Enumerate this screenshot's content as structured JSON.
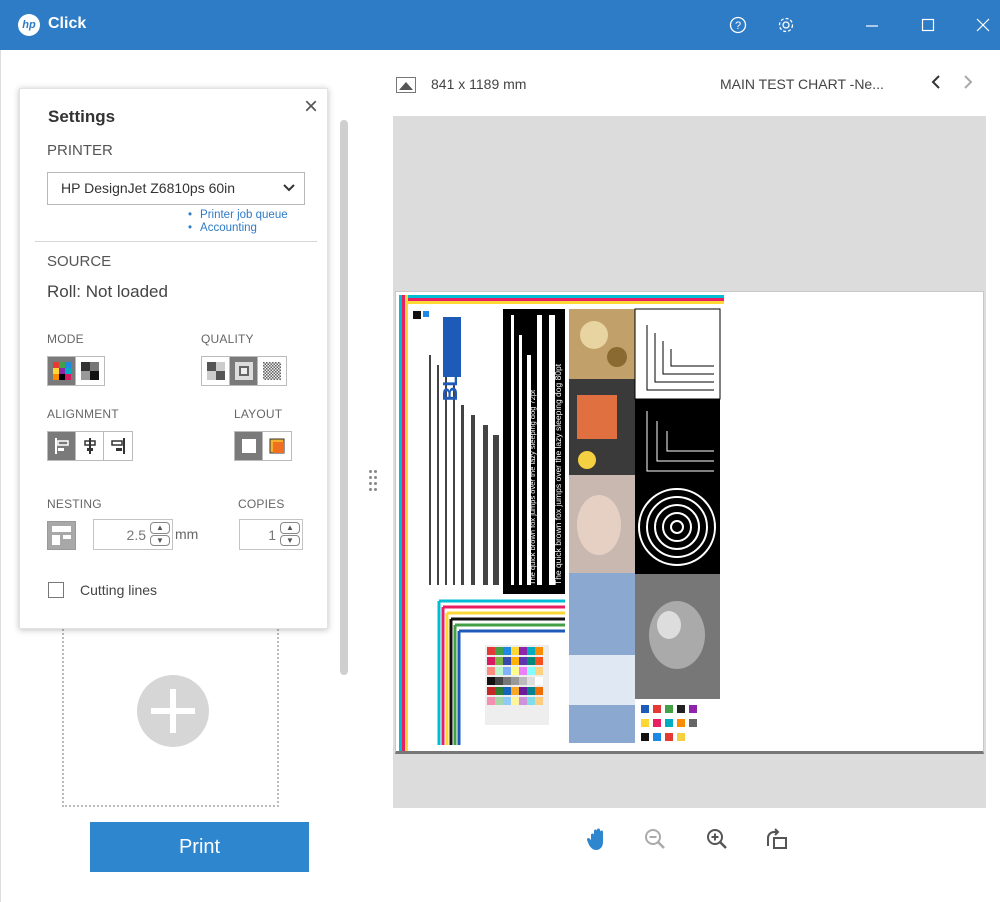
{
  "titlebar": {
    "app_logo": "hp",
    "app_title": "Click",
    "help_icon": "help-icon",
    "settings_icon": "gear-icon",
    "minimize_icon": "minimize-icon",
    "maximize_icon": "maximize-icon",
    "close_icon": "close-icon",
    "color": "#2e7bc6"
  },
  "settings": {
    "title": "Settings",
    "printer_label": "PRINTER",
    "printer_value": "HP DesignJet Z6810ps 60in",
    "links": [
      "Printer job queue",
      "Accounting"
    ],
    "source_label": "SOURCE",
    "source_value": "Roll: Not loaded",
    "mode_label": "MODE",
    "quality_label": "QUALITY",
    "alignment_label": "ALIGNMENT",
    "layout_label": "LAYOUT",
    "nesting_label": "NESTING",
    "nesting_value": "2.5",
    "nesting_unit": "mm",
    "copies_label": "COPIES",
    "copies_value": "1",
    "cutting_lines_label": "Cutting lines"
  },
  "print_button": "Print",
  "preview": {
    "size": "841 x 1189 mm",
    "doc_name": "MAIN TEST CHART -Ne...",
    "chart_logo": "BLI",
    "chart_text": [
      "The quick brown fox jumps over the lazy sleeping dog 72pt",
      "The quick brown fox jumps over the lazy sleeping dog 80pt"
    ]
  },
  "toolbar": [
    "hand-icon",
    "zoom-out-icon",
    "zoom-in-icon",
    "rotate-icon"
  ]
}
